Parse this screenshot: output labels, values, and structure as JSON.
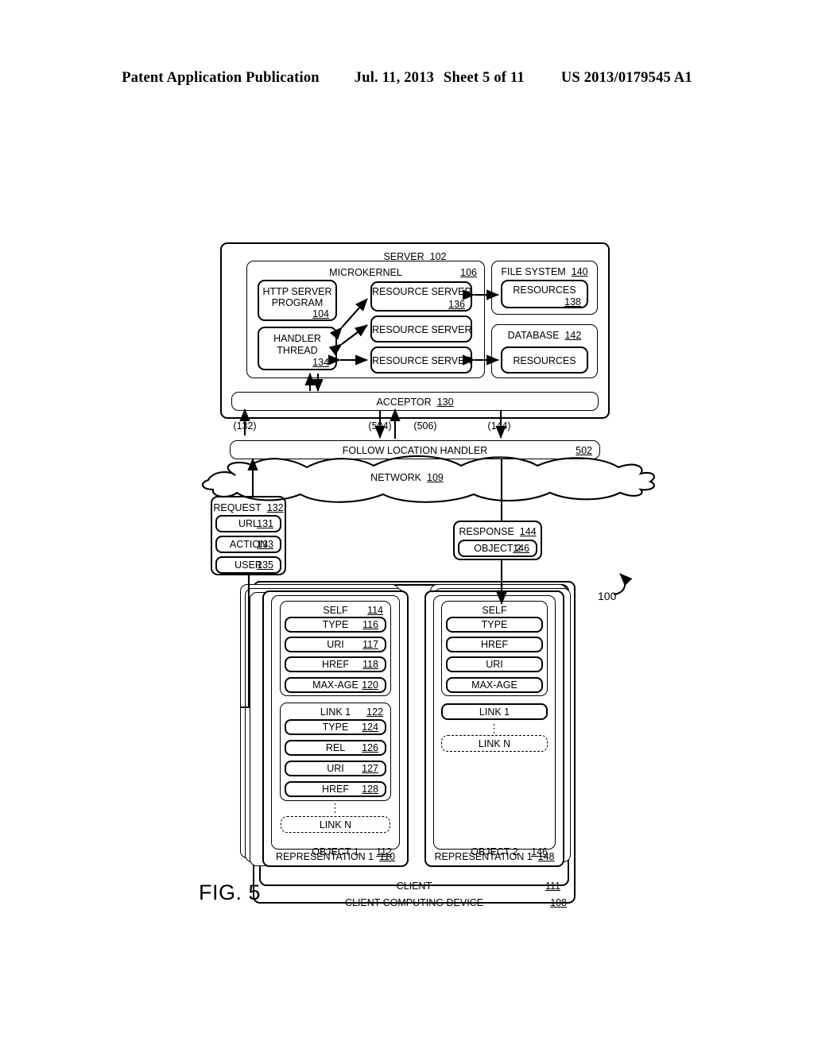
{
  "header": {
    "title": "Patent Application Publication",
    "date": "Jul. 11, 2013",
    "sheet": "Sheet 5 of 11",
    "patent_number": "US 2013/0179545 A1"
  },
  "figure": {
    "label": "FIG. 5",
    "callout": "100"
  },
  "server": {
    "title": "SERVER",
    "ref": "102",
    "microkernel": {
      "title": "MICROKERNEL",
      "ref": "106"
    },
    "http_server_program": {
      "line1": "HTTP SERVER",
      "line2": "PROGRAM",
      "ref": "104"
    },
    "handler_thread": {
      "line1": "HANDLER",
      "line2": "THREAD",
      "ref": "134"
    },
    "resource_servers": [
      {
        "title": "RESOURCE SERVER",
        "ref": "136"
      },
      {
        "title": "RESOURCE SERVER",
        "ref": ""
      },
      {
        "title": "RESOURCE SERVER",
        "ref": ""
      }
    ],
    "file_system": {
      "title": "FILE SYSTEM",
      "ref": "140",
      "resources": {
        "title": "RESOURCES",
        "ref": "138"
      }
    },
    "database": {
      "title": "DATABASE",
      "ref": "142",
      "resources": {
        "title": "RESOURCES",
        "ref": ""
      }
    },
    "acceptor": {
      "title": "ACCEPTOR",
      "ref": "130"
    }
  },
  "flow_labels": [
    "(132)",
    "(504)",
    "(506)",
    "(144)"
  ],
  "follow_location_handler": {
    "title": "FOLLOW LOCATION HANDLER",
    "ref": "502"
  },
  "network": {
    "title": "NETWORK",
    "ref": "109"
  },
  "request": {
    "title": "REQUEST",
    "ref": "132",
    "fields": [
      {
        "label": "URL",
        "ref": "131"
      },
      {
        "label": "ACTION",
        "ref": "133"
      },
      {
        "label": "USER",
        "ref": "135"
      }
    ]
  },
  "response": {
    "title": "RESPONSE",
    "ref": "144",
    "object": {
      "label": "OBJECT 2",
      "ref": "146"
    }
  },
  "client_computing_device": {
    "title": "CLIENT COMPUTING DEVICE",
    "ref": "108"
  },
  "client": {
    "title": "CLIENT",
    "ref": "111"
  },
  "representation_1": {
    "title": "REPRESENTATION 1",
    "ref": "110",
    "object": {
      "title": "OBJECT 1",
      "ref": "112"
    },
    "self_group": {
      "title": "SELF",
      "ref": "114",
      "fields": [
        {
          "label": "TYPE",
          "ref": "116"
        },
        {
          "label": "URI",
          "ref": "117"
        },
        {
          "label": "HREF",
          "ref": "118"
        },
        {
          "label": "MAX-AGE",
          "ref": "120"
        }
      ]
    },
    "link1_group": {
      "title": "LINK 1",
      "ref": "122",
      "fields": [
        {
          "label": "TYPE",
          "ref": "124"
        },
        {
          "label": "REL",
          "ref": "126"
        },
        {
          "label": "URI",
          "ref": "127"
        },
        {
          "label": "HREF",
          "ref": "128"
        }
      ]
    },
    "ellipsis": "⋮",
    "link_n": {
      "label": "LINK N",
      "ref": ""
    }
  },
  "representation_2": {
    "title": "REPRESENTATION 1",
    "ref": "148",
    "object": {
      "title": "OBJECT 2",
      "ref": "146"
    },
    "self_group": {
      "title": "SELF",
      "ref": "",
      "fields": [
        {
          "label": "TYPE",
          "ref": ""
        },
        {
          "label": "HREF",
          "ref": ""
        },
        {
          "label": "URI",
          "ref": ""
        },
        {
          "label": "MAX-AGE",
          "ref": ""
        }
      ]
    },
    "link1": {
      "label": "LINK 1",
      "ref": ""
    },
    "ellipsis": "⋮",
    "link_n": {
      "label": "LINK N",
      "ref": ""
    }
  }
}
